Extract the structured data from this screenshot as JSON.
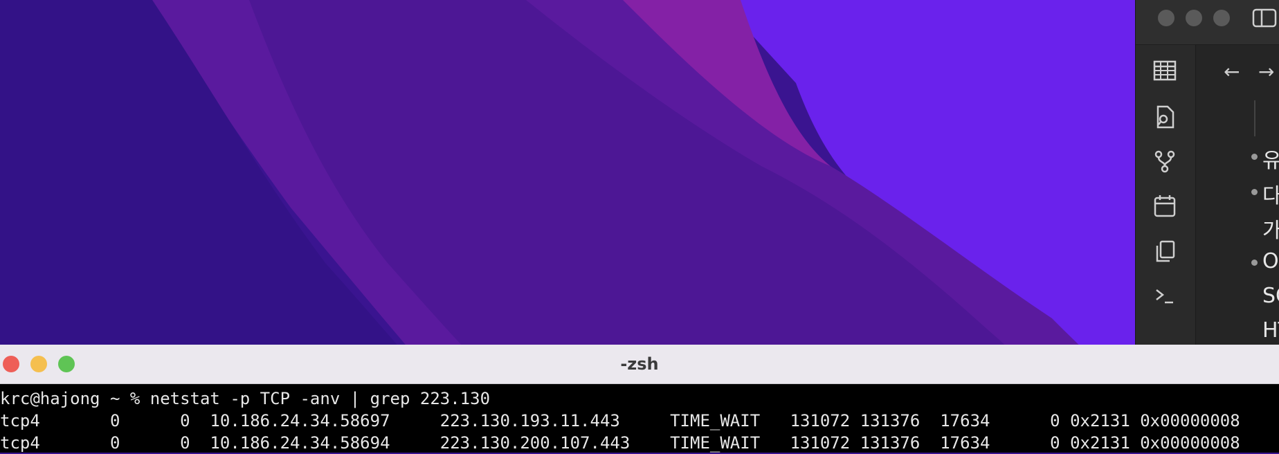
{
  "desktop": {
    "wallpaper": "purple-waves"
  },
  "side_app": {
    "traffic_lights": [
      "close",
      "minimize",
      "zoom"
    ],
    "sidebar_icons": [
      "table-icon",
      "file-search-icon",
      "git-branch-icon",
      "calendar-icon",
      "copy-icon",
      "terminal-prompt-icon"
    ],
    "nav": {
      "back": "←",
      "forward": "→"
    },
    "notes": [
      {
        "text": "유"
      },
      {
        "text": "다"
      },
      {
        "text": "가"
      },
      {
        "text": "O"
      },
      {
        "text": "SC"
      },
      {
        "text": "HT"
      }
    ]
  },
  "terminal": {
    "title": "-zsh",
    "traffic_lights": {
      "close": "#ee5e57",
      "minimize": "#f5bf4f",
      "zoom": "#5fc455"
    },
    "lines": [
      "krc@hajong ~ % netstat -p TCP -anv | grep 223.130",
      "tcp4       0      0  10.186.24.34.58697     223.130.193.11.443     TIME_WAIT   131072 131376  17634      0 0x2131 0x00000008",
      "tcp4       0      0  10.186.24.34.58694     223.130.200.107.443    TIME_WAIT   131072 131376  17634      0 0x2131 0x00000008"
    ]
  }
}
